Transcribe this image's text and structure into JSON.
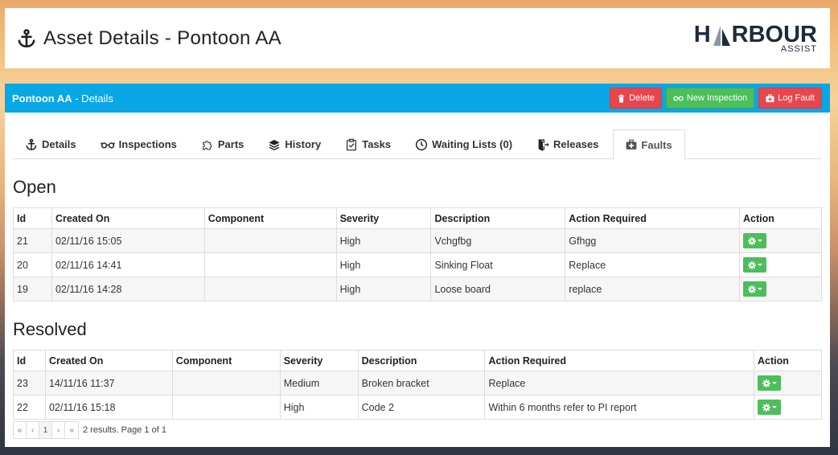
{
  "header": {
    "title": "Asset Details - Pontoon AA",
    "logo_main_prefix": "H",
    "logo_main_suffix": "RBOUR",
    "logo_sub": "ASSIST"
  },
  "panel": {
    "asset_name": "Pontoon AA",
    "subtitle": " - Details",
    "delete_label": "Delete",
    "new_inspection_label": "New Inspection",
    "log_fault_label": "Log Fault"
  },
  "tabs": [
    {
      "label": "Details",
      "icon": "anchor-icon"
    },
    {
      "label": "Inspections",
      "icon": "glasses-icon"
    },
    {
      "label": "Parts",
      "icon": "puzzle-icon"
    },
    {
      "label": "History",
      "icon": "layers-icon"
    },
    {
      "label": "Tasks",
      "icon": "clipboard-check-icon"
    },
    {
      "label": "Waiting Lists (0)",
      "icon": "clock-icon"
    },
    {
      "label": "Releases",
      "icon": "exit-icon"
    },
    {
      "label": "Faults",
      "icon": "first-aid-icon",
      "active": true
    }
  ],
  "open": {
    "title": "Open",
    "columns": [
      "Id",
      "Created On",
      "Component",
      "Severity",
      "Description",
      "Action Required",
      "Action"
    ],
    "rows": [
      [
        "21",
        "02/11/16 15:05",
        "",
        "High",
        "Vchgfbg",
        "Gfhgg"
      ],
      [
        "20",
        "02/11/16 14:41",
        "",
        "High",
        "Sinking Float",
        "Replace"
      ],
      [
        "19",
        "02/11/16 14:28",
        "",
        "High",
        "Loose board",
        "replace"
      ]
    ]
  },
  "resolved": {
    "title": "Resolved",
    "columns": [
      "Id",
      "Created On",
      "Component",
      "Severity",
      "Description",
      "Action Required",
      "Action"
    ],
    "rows": [
      [
        "23",
        "14/11/16 11:37",
        "",
        "Medium",
        "Broken bracket",
        "Replace"
      ],
      [
        "22",
        "02/11/16 15:18",
        "",
        "High",
        "Code 2",
        "Within 6 months refer to PI report"
      ]
    ]
  },
  "pager": {
    "first": "«",
    "prev": "‹",
    "page": "1",
    "next": "›",
    "last": "»",
    "info": "2 results. Page 1 of 1"
  },
  "colors": {
    "panel_header": "#08a7e6",
    "danger": "#e8464d",
    "success": "#4cbe5a"
  }
}
